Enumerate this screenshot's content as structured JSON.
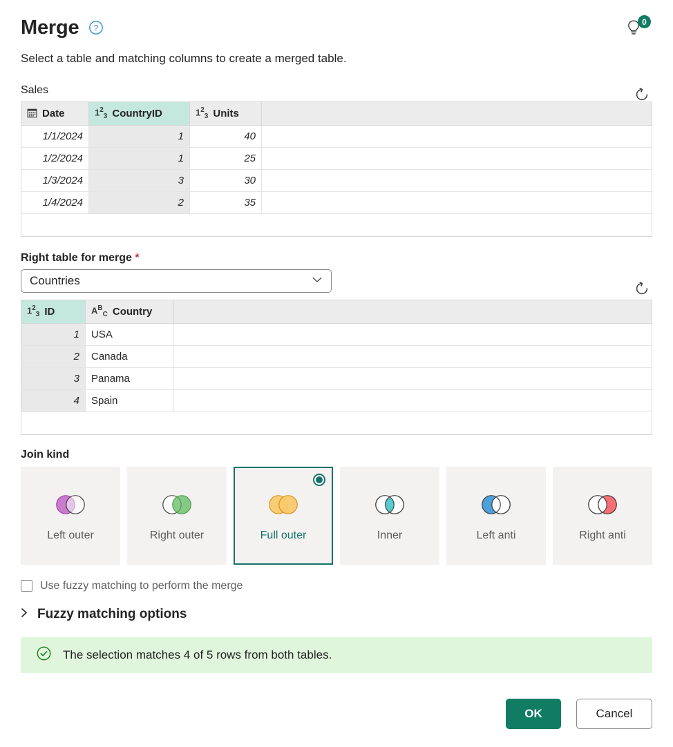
{
  "header": {
    "title": "Merge",
    "help_icon": "question-circle-icon",
    "subtitle": "Select a table and matching columns to create a merged table.",
    "tips_badge_count": "0",
    "tips_icon": "lightbulb-icon"
  },
  "left_table": {
    "label": "Sales",
    "refresh_icon": "refresh-icon",
    "columns": [
      {
        "name": "Date",
        "type_icon": "date-type-icon",
        "selected": false,
        "align": "right"
      },
      {
        "name": "CountryID",
        "type_icon": "number-type-icon",
        "selected": true,
        "align": "right"
      },
      {
        "name": "Units",
        "type_icon": "number-type-icon",
        "selected": false,
        "align": "right"
      }
    ],
    "rows": [
      [
        "1/1/2024",
        "1",
        "40"
      ],
      [
        "1/2/2024",
        "1",
        "25"
      ],
      [
        "1/3/2024",
        "3",
        "30"
      ],
      [
        "1/4/2024",
        "2",
        "35"
      ]
    ]
  },
  "right_table_field": {
    "label": "Right table for merge",
    "required_marker": "*",
    "selected_value": "Countries",
    "chevron_icon": "chevron-down-icon",
    "refresh_icon": "refresh-icon"
  },
  "right_table": {
    "columns": [
      {
        "name": "ID",
        "type_icon": "number-type-icon",
        "selected": true,
        "align": "right"
      },
      {
        "name": "Country",
        "type_icon": "text-type-icon",
        "selected": false,
        "align": "left"
      }
    ],
    "rows": [
      [
        "1",
        "USA"
      ],
      [
        "2",
        "Canada"
      ],
      [
        "3",
        "Panama"
      ],
      [
        "4",
        "Spain"
      ]
    ]
  },
  "join_kind": {
    "label": "Join kind",
    "selected": "Full outer",
    "options": [
      {
        "label": "Left outer",
        "color": "#b94ec0",
        "fill": "left"
      },
      {
        "label": "Right outer",
        "color": "#5cb85c",
        "fill": "right"
      },
      {
        "label": "Full outer",
        "color": "#f2b441",
        "fill": "both"
      },
      {
        "label": "Inner",
        "color": "#2bbfc4",
        "fill": "intersection"
      },
      {
        "label": "Left anti",
        "color": "#2e8fd4",
        "fill": "left-only"
      },
      {
        "label": "Right anti",
        "color": "#f5565c",
        "fill": "right-only"
      }
    ]
  },
  "fuzzy": {
    "checkbox_label": "Use fuzzy matching to perform the merge",
    "checked": false,
    "expander_label": "Fuzzy matching options",
    "expander_icon": "chevron-right-icon",
    "expanded": false
  },
  "status": {
    "icon": "check-circle-icon",
    "message": "The selection matches 4 of 5 rows from both tables.",
    "color": "#107C10"
  },
  "footer": {
    "ok_label": "OK",
    "cancel_label": "Cancel"
  }
}
